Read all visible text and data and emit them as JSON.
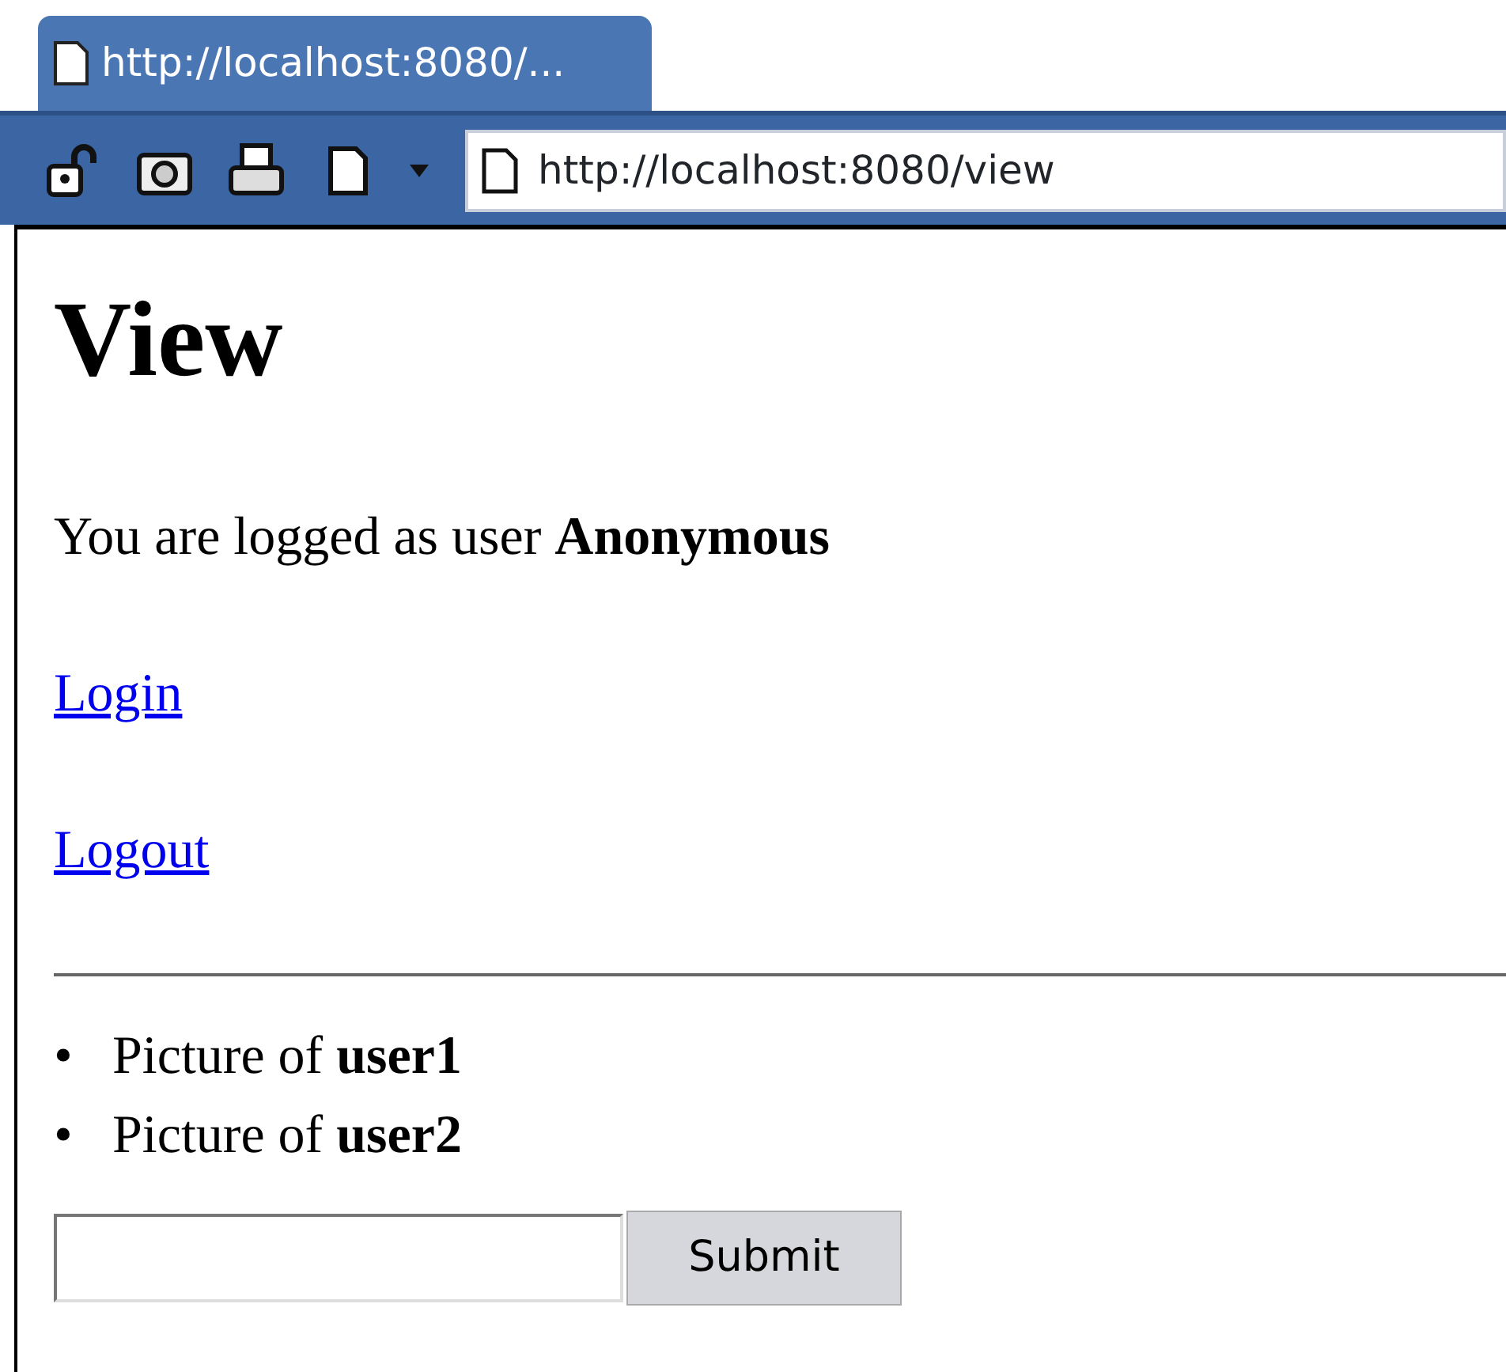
{
  "tab": {
    "title": "http://localhost:8080/..."
  },
  "toolbar": {
    "address": "http://localhost:8080/view"
  },
  "page": {
    "heading": "View",
    "status": "You are logged as user **Anonymous**",
    "links": [
      "Login",
      "Logout"
    ],
    "pictures": [
      {
        "bullet": "•",
        "text": "Picture of **user1**"
      },
      {
        "bullet": "•",
        "text": "Picture of **user2**"
      }
    ],
    "form": {
      "button": "Submit"
    }
  }
}
